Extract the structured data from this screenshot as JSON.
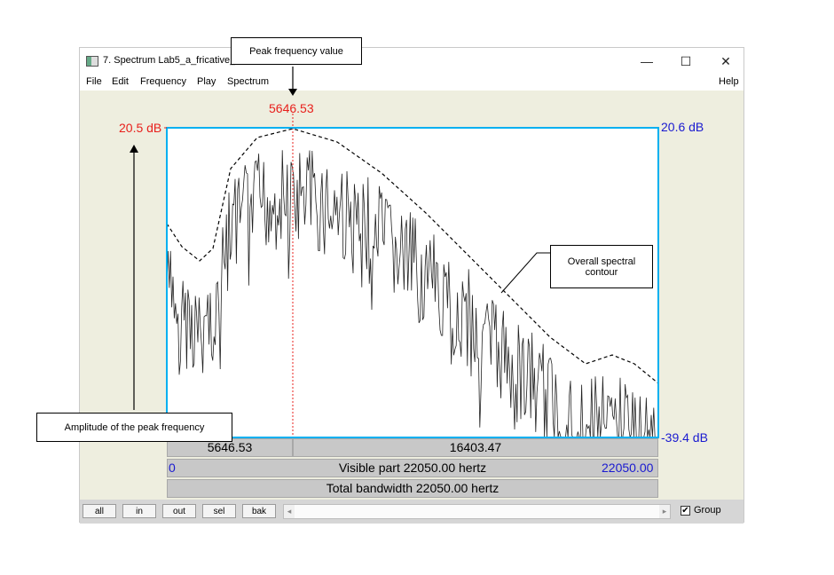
{
  "window": {
    "title": "7. Spectrum Lab5_a_fricative_",
    "minimize": "—",
    "maximize": "☐",
    "close": "✕"
  },
  "menu": {
    "items": [
      "File",
      "Edit",
      "Frequency",
      "Play",
      "Spectrum"
    ],
    "help": "Help"
  },
  "plot": {
    "peak_freq_top": "5646.53",
    "left_amplitude": "20.5 dB",
    "right_top_db": "20.6 dB",
    "right_bottom_db": "-39.4 dB",
    "cursor_left_value": "5646.53",
    "cursor_right_value": "16403.47",
    "visible_start": "0",
    "visible_label": "Visible part 22050.00 hertz",
    "visible_end": "22050.00",
    "total_label": "Total bandwidth 22050.00 hertz",
    "colors": {
      "spectrum": "#222222",
      "frame": "#00b0f0",
      "cursor": "#e8201c",
      "bg": "#eeeedf"
    }
  },
  "annotations": {
    "peak_value": "Peak frequency value",
    "peak_amplitude": "Amplitude of the peak frequency",
    "contour": "Overall spectral contour"
  },
  "bottom": {
    "buttons": [
      "all",
      "in",
      "out",
      "sel",
      "bak"
    ],
    "scroll_left": "◂",
    "scroll_right": "▸",
    "group_checked": "✔",
    "group_label": "Group"
  }
}
